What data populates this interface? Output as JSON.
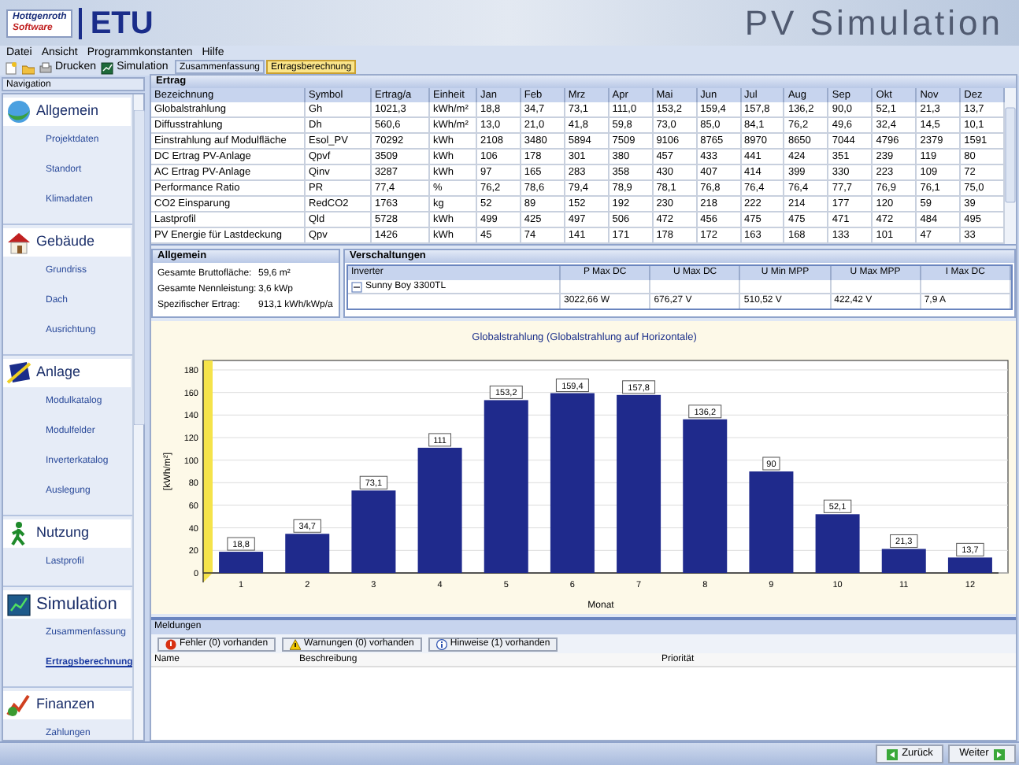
{
  "header": {
    "logo_top": "Hottgenroth",
    "logo_bottom": "Software",
    "brand": "ETU",
    "title": "PV Simulation"
  },
  "menu": [
    "Datei",
    "Ansicht",
    "Programmkonstanten",
    "Hilfe"
  ],
  "toolbar": [
    {
      "kind": "new"
    },
    {
      "kind": "open"
    },
    {
      "kind": "print",
      "label": "Drucken"
    },
    {
      "kind": "simulation",
      "label": "Simulation"
    }
  ],
  "navigation": {
    "title": "Navigation",
    "groups": [
      {
        "kind": "globe",
        "label": "Allgemein",
        "items": [
          {
            "label": "Projektdaten",
            "selected": false
          },
          {
            "label": "Standort",
            "selected": false
          },
          {
            "label": "Klimadaten",
            "selected": false
          }
        ]
      },
      {
        "kind": "house",
        "label": "Gebäude",
        "items": [
          {
            "label": "Grundriss",
            "selected": false
          },
          {
            "label": "Dach",
            "selected": false
          },
          {
            "label": "Ausrichtung",
            "selected": false
          }
        ]
      },
      {
        "kind": "panel",
        "label": "Anlage",
        "items": [
          {
            "label": "Modulkatalog",
            "selected": false
          },
          {
            "label": "Modulfelder",
            "selected": false
          },
          {
            "label": "Inverterkatalog",
            "selected": false
          },
          {
            "label": "Auslegung",
            "selected": false
          }
        ]
      },
      {
        "kind": "walker",
        "label": "Nutzung",
        "items": [
          {
            "label": "Lastprofil",
            "selected": false
          }
        ]
      },
      {
        "kind": "chart",
        "label": "Simulation",
        "items": [
          {
            "label": "Zusammenfassung",
            "selected": false
          },
          {
            "label": "Ertragsberechnung",
            "selected": true
          }
        ]
      },
      {
        "kind": "finance",
        "label": "Finanzen",
        "items": [
          {
            "label": "Zahlungen",
            "selected": false
          }
        ]
      }
    ]
  },
  "tabs": [
    {
      "label": "Zusammenfassung",
      "selected": false
    },
    {
      "label": "Ertragsberechnung",
      "selected": true
    }
  ],
  "ertrag": {
    "title": "Ertrag",
    "columns": [
      "Bezeichnung",
      "Symbol",
      "Ertrag/a",
      "Einheit",
      "Jan",
      "Feb",
      "Mrz",
      "Apr",
      "Mai",
      "Jun",
      "Jul",
      "Aug",
      "Sep",
      "Okt",
      "Nov",
      "Dez"
    ],
    "rows": [
      [
        "Globalstrahlung",
        "Gh",
        "1021,3",
        "kWh/m²",
        "18,8",
        "34,7",
        "73,1",
        "111,0",
        "153,2",
        "159,4",
        "157,8",
        "136,2",
        "90,0",
        "52,1",
        "21,3",
        "13,7"
      ],
      [
        "Diffusstrahlung",
        "Dh",
        "560,6",
        "kWh/m²",
        "13,0",
        "21,0",
        "41,8",
        "59,8",
        "73,0",
        "85,0",
        "84,1",
        "76,2",
        "49,6",
        "32,4",
        "14,5",
        "10,1"
      ],
      [
        "Einstrahlung auf Modulfläche",
        "Esol_PV",
        "70292",
        "kWh",
        "2108",
        "3480",
        "5894",
        "7509",
        "9106",
        "8765",
        "8970",
        "8650",
        "7044",
        "4796",
        "2379",
        "1591"
      ],
      [
        "DC Ertrag PV-Anlage",
        "Qpvf",
        "3509",
        "kWh",
        "106",
        "178",
        "301",
        "380",
        "457",
        "433",
        "441",
        "424",
        "351",
        "239",
        "119",
        "80"
      ],
      [
        "AC Ertrag PV-Anlage",
        "Qinv",
        "3287",
        "kWh",
        "97",
        "165",
        "283",
        "358",
        "430",
        "407",
        "414",
        "399",
        "330",
        "223",
        "109",
        "72"
      ],
      [
        "Performance Ratio",
        "PR",
        "77,4",
        "%",
        "76,2",
        "78,6",
        "79,4",
        "78,9",
        "78,1",
        "76,8",
        "76,4",
        "76,4",
        "77,7",
        "76,9",
        "76,1",
        "75,0"
      ],
      [
        "CO2 Einsparung",
        "RedCO2",
        "1763",
        "kg",
        "52",
        "89",
        "152",
        "192",
        "230",
        "218",
        "222",
        "214",
        "177",
        "120",
        "59",
        "39"
      ],
      [
        "Lastprofil",
        "Qld",
        "5728",
        "kWh",
        "499",
        "425",
        "497",
        "506",
        "472",
        "456",
        "475",
        "475",
        "471",
        "472",
        "484",
        "495"
      ],
      [
        "PV Energie für Lastdeckung",
        "Qpv",
        "1426",
        "kWh",
        "45",
        "74",
        "141",
        "171",
        "178",
        "172",
        "163",
        "168",
        "133",
        "101",
        "47",
        "33"
      ]
    ]
  },
  "allgemein": {
    "title": "Allgemein",
    "fields": [
      {
        "label": "Gesamte Bruttofläche:",
        "value": "59,6 m²"
      },
      {
        "label": "Gesamte Nennleistung:",
        "value": "3,6 kWp"
      },
      {
        "label": "Spezifischer Ertrag:",
        "value": "913,1 kWh/kWp/a"
      }
    ]
  },
  "verschaltungen": {
    "title": "Verschaltungen",
    "columns": [
      "Inverter",
      "P Max DC",
      "U Max DC",
      "U Min MPP",
      "U Max MPP",
      "I Max DC"
    ],
    "inverter": {
      "name": "Sunny Boy 3300TL",
      "expanded": true,
      "values": [
        "3022,66 W",
        "676,27 V",
        "510,52 V",
        "422,42 V",
        "7,9 A"
      ]
    }
  },
  "chart": {
    "chart_data": {
      "type": "bar",
      "title": "Globalstrahlung (Globalstrahlung auf Horizontale)",
      "xlabel": "Monat",
      "ylabel": "[kWh/m²]",
      "categories": [
        "1",
        "2",
        "3",
        "4",
        "5",
        "6",
        "7",
        "8",
        "9",
        "10",
        "11",
        "12"
      ],
      "values": [
        18.8,
        34.7,
        73.1,
        111,
        153.2,
        159.4,
        157.8,
        136.2,
        90,
        52.1,
        21.3,
        13.7
      ],
      "ylim": [
        0,
        180
      ],
      "grid": true,
      "yticks": [
        0,
        20,
        40,
        60,
        80,
        100,
        120,
        140,
        160,
        180
      ],
      "value_labels": [
        "18,8",
        "34,7",
        "73,1",
        "111",
        "153,2",
        "159,4",
        "157,8",
        "136,2",
        "90",
        "52,1",
        "21,3",
        "13,7"
      ]
    }
  },
  "meldungen": {
    "title": "Meldungen",
    "filters": [
      {
        "kind": "error",
        "label": "Fehler (0) vorhanden"
      },
      {
        "kind": "warning",
        "label": "Warnungen (0) vorhanden"
      },
      {
        "kind": "info",
        "label": "Hinweise (1) vorhanden"
      }
    ],
    "columns": [
      "Name",
      "Beschreibung",
      "Priorität"
    ]
  },
  "footer": {
    "buttons": [
      {
        "kind": "back",
        "label": "Zurück"
      },
      {
        "kind": "next",
        "label": "Weiter"
      }
    ]
  }
}
